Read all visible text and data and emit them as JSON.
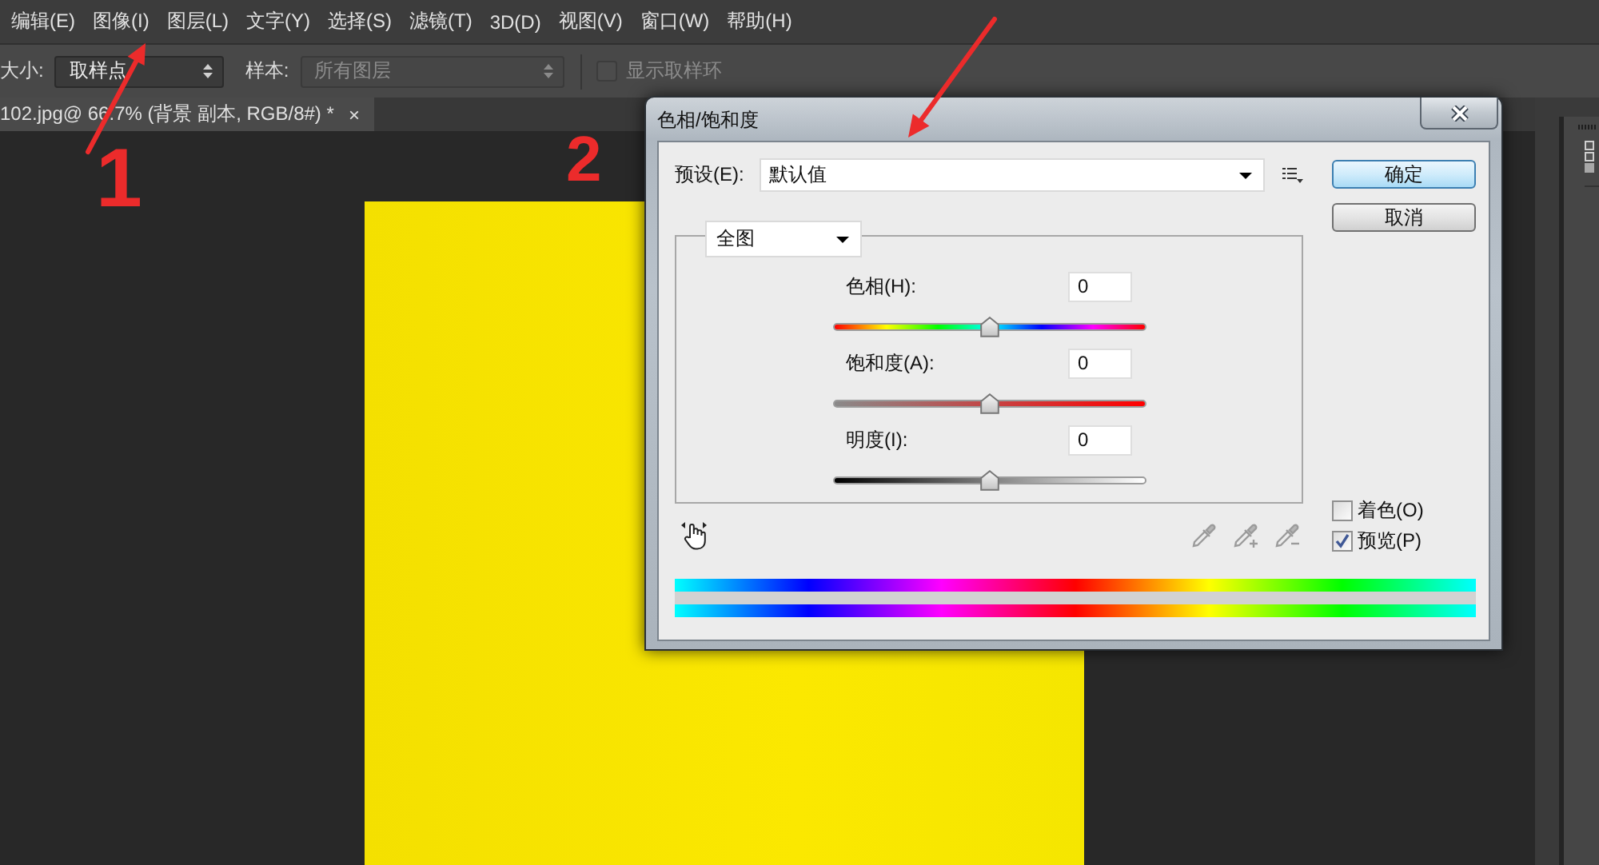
{
  "menu_bar": {
    "items": [
      "编辑(E)",
      "图像(I)",
      "图层(L)",
      "文字(Y)",
      "选择(S)",
      "滤镜(T)",
      "3D(D)",
      "视图(V)",
      "窗口(W)",
      "帮助(H)"
    ]
  },
  "options_bar": {
    "size_label": "大小:",
    "size_value": "取样点",
    "sample_label": "样本:",
    "sample_value": "所有图层",
    "sample_disabled": true,
    "ring_label": "显示取样环",
    "ring_checked": false,
    "ring_disabled": true
  },
  "document_tab": {
    "title": "102.jpg@ 66.7% (背景 副本, RGB/8#) *",
    "close": "×",
    "selected": true
  },
  "dialog": {
    "title": "色相/饱和度",
    "preset_label": "预设(E):",
    "preset_value": "默认值",
    "channel": "全图",
    "sliders": [
      {
        "kind": "hue",
        "label": "色相(H):",
        "value": "0",
        "level": 0.5
      },
      {
        "kind": "saturation",
        "label": "饱和度(A):",
        "value": "0",
        "level": 0.5
      },
      {
        "kind": "lightness",
        "label": "明度(I):",
        "value": "0",
        "level": 0.5
      }
    ],
    "eyedroppers": [
      {
        "kind": "sample",
        "disabled": true
      },
      {
        "kind": "add",
        "disabled": true
      },
      {
        "kind": "subtract",
        "disabled": true
      }
    ],
    "buttons": [
      {
        "label": "确定",
        "default": true
      },
      {
        "label": "取消",
        "default": false
      }
    ],
    "checkboxes": [
      {
        "label": "着色(O)",
        "checked": false
      },
      {
        "label": "预览(P)",
        "checked": true
      }
    ]
  },
  "annotations": [
    {
      "label": "1"
    },
    {
      "label": "2"
    }
  ]
}
